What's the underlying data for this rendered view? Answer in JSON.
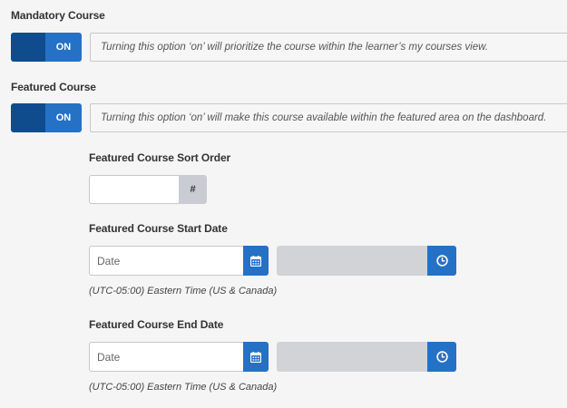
{
  "mandatory": {
    "label": "Mandatory Course",
    "toggle_label": "ON",
    "help": "Turning this option ‘on’ will prioritize the course within the learner’s my courses view."
  },
  "featured": {
    "label": "Featured Course",
    "toggle_label": "ON",
    "help": "Turning this option ‘on’ will make this course available within the featured area on the dashboard."
  },
  "sort_order": {
    "label": "Featured Course Sort Order",
    "value": "",
    "addon": "#"
  },
  "start_date": {
    "label": "Featured Course Start Date",
    "placeholder": "Date",
    "timezone": "(UTC-05:00) Eastern Time (US & Canada)"
  },
  "end_date": {
    "label": "Featured Course End Date",
    "placeholder": "Date",
    "timezone": "(UTC-05:00) Eastern Time (US & Canada)"
  },
  "icons": {
    "calendar": "calendar-icon",
    "clock": "clock-icon"
  },
  "colors": {
    "toggle_dark": "#0f4c8e",
    "accent_blue": "#2571c6",
    "disabled_gray": "#d2d3d6"
  }
}
